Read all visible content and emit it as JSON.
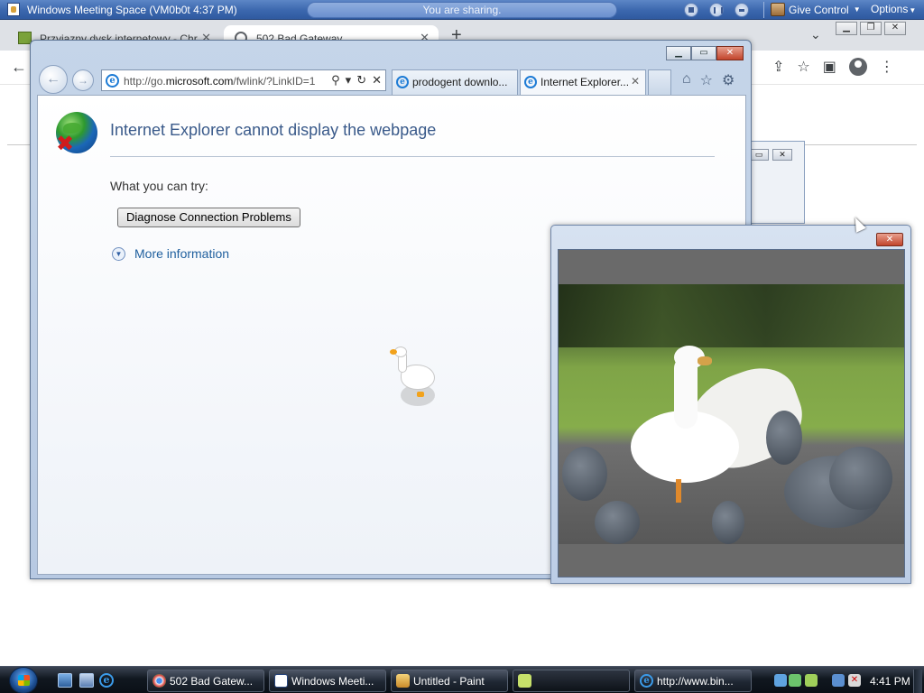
{
  "meeting_bar": {
    "title": "Windows Meeting Space (VM0b0t 4:37 PM)",
    "sharing_status": "You are sharing.",
    "give_control": "Give Control",
    "options": "Options"
  },
  "chrome": {
    "tabs": [
      {
        "label": "Przyjazny dysk internetowy - Chr",
        "icon": "drive-icon"
      },
      {
        "label": "502 Bad Gateway",
        "icon": "globe-icon",
        "active": true
      }
    ],
    "new_tab": "+"
  },
  "ie": {
    "url_prefix": "http://go.",
    "url_domain": "microsoft.com",
    "url_suffix": "/fwlink/?LinkID=1",
    "tabs": [
      {
        "label": "prodogent downlo..."
      },
      {
        "label": "Internet Explorer...",
        "active": true
      }
    ],
    "error": {
      "title": "Internet Explorer cannot display the webpage",
      "what_you_can_try": "What you can try:",
      "diagnose_button": "Diagnose Connection Problems",
      "more_information": "More information"
    }
  },
  "taskbar": {
    "items": [
      {
        "label": "502 Bad Gatew...",
        "icon": "chrome-icon"
      },
      {
        "label": "Windows Meeti...",
        "icon": "meeting-space-icon"
      },
      {
        "label": "Untitled - Paint",
        "icon": "paint-icon"
      },
      {
        "label": "",
        "icon": "video-icon",
        "active": true
      },
      {
        "label": "http://www.bin...",
        "icon": "ie-icon"
      }
    ],
    "clock": "4:41 PM"
  },
  "colors": {
    "meeting_bar": "#3b67ae",
    "ie_error_title": "#3a5a8a",
    "link": "#1f5f9e",
    "close_button": "#c2442b",
    "taskbar": "#111820"
  }
}
